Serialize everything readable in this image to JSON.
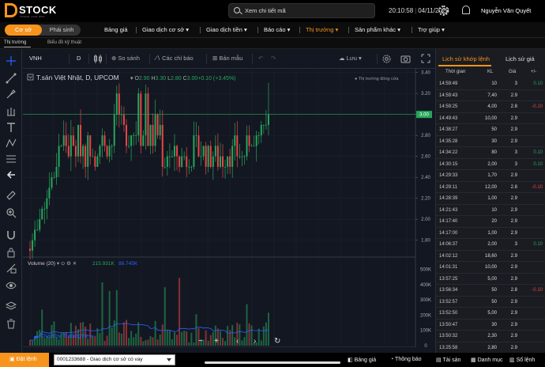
{
  "app": {
    "brand": "STOCK",
    "brand_initial": "D",
    "tagline": "TRADE LIKE PRO"
  },
  "header": {
    "search_placeholder": "Xem chi tiết mã",
    "time": "20:10:58",
    "date": "04/11/2023",
    "user": "Nguyễn Văn Quyết"
  },
  "segment": {
    "active": "Cơ sở",
    "inactive": "Phái sinh"
  },
  "nav": [
    {
      "label": "Bảng giá"
    },
    {
      "label": "Giao dịch cơ sở ▾"
    },
    {
      "label": "Giao dịch tiền ▾"
    },
    {
      "label": "Báo cáo ▾"
    },
    {
      "label": "Thị trường ▾",
      "active": true
    },
    {
      "label": "Sản phẩm khác ▾"
    },
    {
      "label": "Trợ giúp ▾"
    }
  ],
  "breadcrumb": {
    "first": "Thị trường",
    "second": "Biểu đồ kỹ thuật"
  },
  "toolbar": {
    "symbol": "VNH",
    "interval": "D",
    "compare": "So sánh",
    "indicators": "Các chỉ báo",
    "template": "Bản mẫu",
    "save": "Lưu"
  },
  "chart_data": {
    "type": "candlestick",
    "title": "T.sản Việt Nhật, D, UPCOM",
    "ohlc": {
      "o": "2.90",
      "h": "3.30",
      "l": "2.80",
      "c": "3.00",
      "chg": "+0.10 (+3.45%)"
    },
    "status": "Thị trường đóng cửa",
    "price_axis": {
      "min": 1.7,
      "max": 3.42,
      "ticks": [
        "3.60",
        "3.40",
        "3.20",
        "3.00",
        "2.80",
        "2.60",
        "2.40",
        "2.20",
        "2.00",
        "1.80"
      ],
      "current": "3.00"
    },
    "volume": {
      "label": "Volume (20)",
      "value1": "215.931K",
      "value2": "88.745K",
      "max": 560000,
      "ticks": [
        "500K",
        "400K",
        "300K",
        "200K",
        "100K",
        "0"
      ]
    },
    "watermark": "Chart by TradingView",
    "colors": {
      "up": "#26a65b",
      "down": "#e84545",
      "ma": "#2962ff"
    }
  },
  "side": {
    "tab_active": "Lịch sử khớp lệnh",
    "tab_other": "Lịch sử giá",
    "cols": [
      "Thời gian",
      "KL",
      "Giá",
      "+/-"
    ],
    "trades": [
      {
        "t": "14:59:49",
        "k": "10",
        "p": "3",
        "d": "0.10",
        "c": "up"
      },
      {
        "t": "14:59:43",
        "k": "7,40",
        "p": "2.9",
        "d": "",
        "c": "fl"
      },
      {
        "t": "14:59:25",
        "k": "4,00",
        "p": "2.8",
        "d": "-0.10",
        "c": "dn"
      },
      {
        "t": "14:49:43",
        "k": "10,00",
        "p": "2.9",
        "d": "",
        "c": "fl"
      },
      {
        "t": "14:38:27",
        "k": "50",
        "p": "2.9",
        "d": "",
        "c": "fl"
      },
      {
        "t": "14:35:28",
        "k": "30",
        "p": "2.9",
        "d": "",
        "c": "fl"
      },
      {
        "t": "14:34:22",
        "k": "80",
        "p": "3",
        "d": "0.10",
        "c": "up"
      },
      {
        "t": "14:30:15",
        "k": "2,00",
        "p": "3",
        "d": "0.10",
        "c": "up"
      },
      {
        "t": "14:29:33",
        "k": "1,70",
        "p": "2.9",
        "d": "",
        "c": "fl"
      },
      {
        "t": "14:29:11",
        "k": "12,00",
        "p": "2.8",
        "d": "-0.10",
        "c": "dn"
      },
      {
        "t": "14:28:39",
        "k": "1,00",
        "p": "2.9",
        "d": "",
        "c": "fl"
      },
      {
        "t": "14:21:43",
        "k": "10",
        "p": "2.9",
        "d": "",
        "c": "fl"
      },
      {
        "t": "14:17:40",
        "k": "20",
        "p": "2.9",
        "d": "",
        "c": "fl"
      },
      {
        "t": "14:17:00",
        "k": "1,00",
        "p": "2.9",
        "d": "",
        "c": "fl"
      },
      {
        "t": "14:06:37",
        "k": "2,00",
        "p": "3",
        "d": "0.10",
        "c": "up"
      },
      {
        "t": "14:02:12",
        "k": "18,60",
        "p": "2.9",
        "d": "",
        "c": "fl"
      },
      {
        "t": "14:01:31",
        "k": "10,00",
        "p": "2.9",
        "d": "",
        "c": "fl"
      },
      {
        "t": "13:57:25",
        "k": "5,00",
        "p": "2.9",
        "d": "",
        "c": "fl"
      },
      {
        "t": "13:56:34",
        "k": "50",
        "p": "2.8",
        "d": "-0.10",
        "c": "dn"
      },
      {
        "t": "13:52:57",
        "k": "50",
        "p": "2.9",
        "d": "",
        "c": "fl"
      },
      {
        "t": "13:52:50",
        "k": "5,00",
        "p": "2.9",
        "d": "",
        "c": "fl"
      },
      {
        "t": "13:50:47",
        "k": "30",
        "p": "2.9",
        "d": "",
        "c": "fl"
      },
      {
        "t": "13:50:32",
        "k": "2,30",
        "p": "2.9",
        "d": "",
        "c": "fl"
      },
      {
        "t": "13:25:58",
        "k": "2,80",
        "p": "2.9",
        "d": "",
        "c": "fl"
      }
    ]
  },
  "bottom": {
    "order": "Đặt lệnh",
    "account": "0001233688 - Giao dịch cơ sở có vay",
    "links": [
      "Bảng giá",
      "Thông báo",
      "Tài sản",
      "Danh mục",
      "Sổ lệnh"
    ]
  }
}
